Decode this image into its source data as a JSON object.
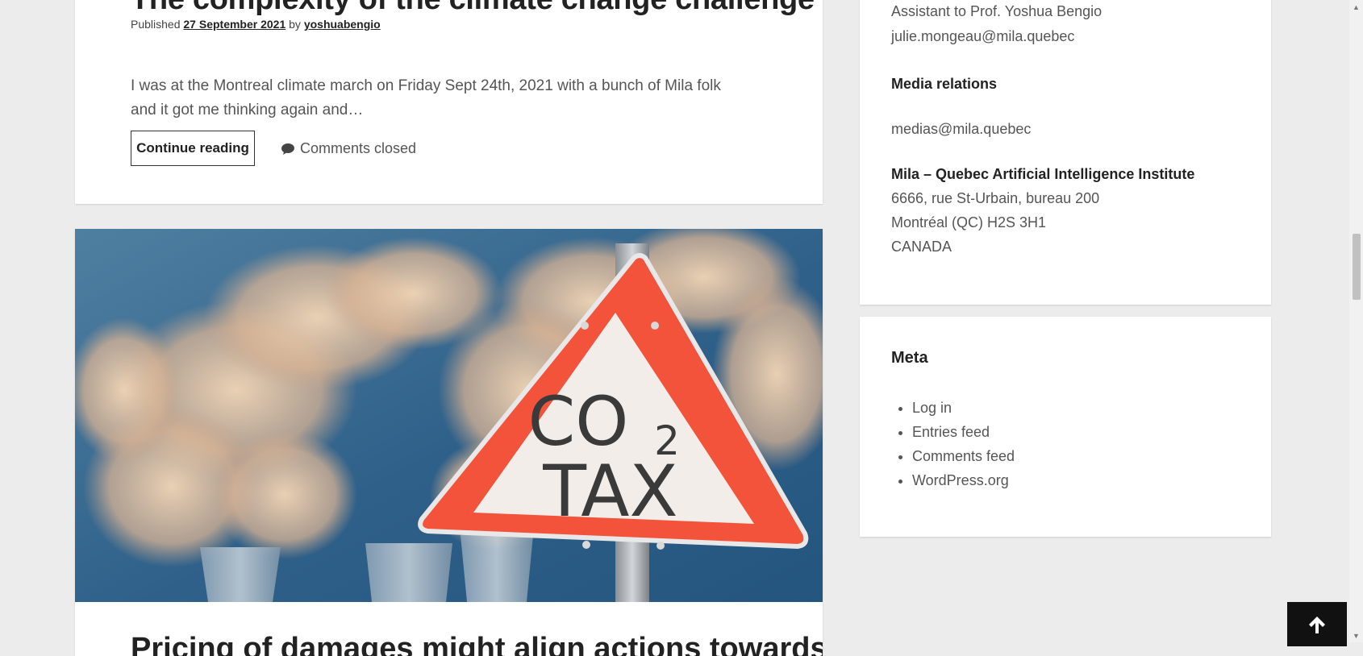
{
  "post1": {
    "title": "The complexity of the climate change challenge",
    "published_prefix": "Published",
    "published_date": "27 September 2021",
    "by": "by",
    "author": "yoshuabengio",
    "excerpt": "I was at the Montreal climate march on Friday Sept 24th, 2021 with a bunch of Mila folk and it got me thinking again and…",
    "continue_label": "Continue reading",
    "comments_label": "Comments closed"
  },
  "post2": {
    "image_sign_line1": "CO",
    "image_sign_sub": "2",
    "image_sign_line2": "TAX",
    "title": "Pricing of damages might align actions towards…"
  },
  "sidebar": {
    "contact": {
      "assistant": "Assistant to Prof. Yoshua Bengio",
      "assistant_email": "julie.mongeau@mila.quebec",
      "media_heading": "Media relations",
      "media_email": "medias@mila.quebec",
      "institute_name": "Mila – Quebec Artificial Intelligence Institute",
      "address_line1": "6666, rue St-Urbain, bureau 200",
      "address_line2": "Montréal (QC) H2S 3H1",
      "address_line3": "CANADA"
    },
    "meta": {
      "title": "Meta",
      "links": [
        "Log in",
        "Entries feed",
        "Comments feed",
        "WordPress.org"
      ]
    }
  },
  "icons": {
    "comment": "comment-icon",
    "back_to_top": "arrow-up-icon"
  },
  "colors": {
    "page_bg": "#ececec",
    "sign_red": "#f2533a",
    "back_to_top_bg": "#111111"
  }
}
